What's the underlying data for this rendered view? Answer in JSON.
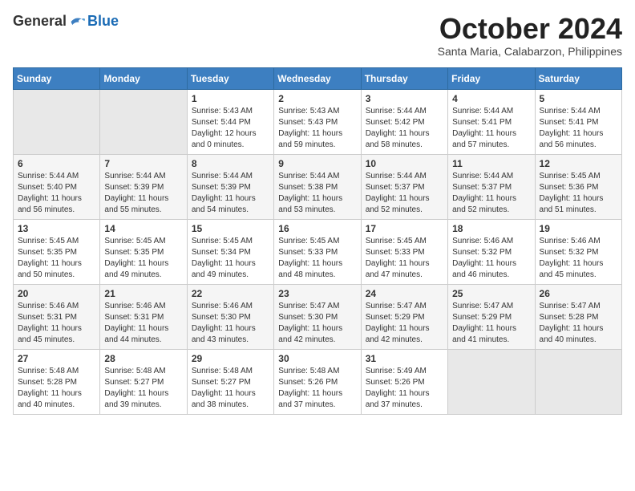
{
  "header": {
    "logo_general": "General",
    "logo_blue": "Blue",
    "month_title": "October 2024",
    "subtitle": "Santa Maria, Calabarzon, Philippines"
  },
  "weekdays": [
    "Sunday",
    "Monday",
    "Tuesday",
    "Wednesday",
    "Thursday",
    "Friday",
    "Saturday"
  ],
  "weeks": [
    [
      {
        "day": "",
        "empty": true
      },
      {
        "day": "",
        "empty": true
      },
      {
        "day": "1",
        "sunrise": "Sunrise: 5:43 AM",
        "sunset": "Sunset: 5:44 PM",
        "daylight": "Daylight: 12 hours and 0 minutes."
      },
      {
        "day": "2",
        "sunrise": "Sunrise: 5:43 AM",
        "sunset": "Sunset: 5:43 PM",
        "daylight": "Daylight: 11 hours and 59 minutes."
      },
      {
        "day": "3",
        "sunrise": "Sunrise: 5:44 AM",
        "sunset": "Sunset: 5:42 PM",
        "daylight": "Daylight: 11 hours and 58 minutes."
      },
      {
        "day": "4",
        "sunrise": "Sunrise: 5:44 AM",
        "sunset": "Sunset: 5:41 PM",
        "daylight": "Daylight: 11 hours and 57 minutes."
      },
      {
        "day": "5",
        "sunrise": "Sunrise: 5:44 AM",
        "sunset": "Sunset: 5:41 PM",
        "daylight": "Daylight: 11 hours and 56 minutes."
      }
    ],
    [
      {
        "day": "6",
        "sunrise": "Sunrise: 5:44 AM",
        "sunset": "Sunset: 5:40 PM",
        "daylight": "Daylight: 11 hours and 56 minutes."
      },
      {
        "day": "7",
        "sunrise": "Sunrise: 5:44 AM",
        "sunset": "Sunset: 5:39 PM",
        "daylight": "Daylight: 11 hours and 55 minutes."
      },
      {
        "day": "8",
        "sunrise": "Sunrise: 5:44 AM",
        "sunset": "Sunset: 5:39 PM",
        "daylight": "Daylight: 11 hours and 54 minutes."
      },
      {
        "day": "9",
        "sunrise": "Sunrise: 5:44 AM",
        "sunset": "Sunset: 5:38 PM",
        "daylight": "Daylight: 11 hours and 53 minutes."
      },
      {
        "day": "10",
        "sunrise": "Sunrise: 5:44 AM",
        "sunset": "Sunset: 5:37 PM",
        "daylight": "Daylight: 11 hours and 52 minutes."
      },
      {
        "day": "11",
        "sunrise": "Sunrise: 5:44 AM",
        "sunset": "Sunset: 5:37 PM",
        "daylight": "Daylight: 11 hours and 52 minutes."
      },
      {
        "day": "12",
        "sunrise": "Sunrise: 5:45 AM",
        "sunset": "Sunset: 5:36 PM",
        "daylight": "Daylight: 11 hours and 51 minutes."
      }
    ],
    [
      {
        "day": "13",
        "sunrise": "Sunrise: 5:45 AM",
        "sunset": "Sunset: 5:35 PM",
        "daylight": "Daylight: 11 hours and 50 minutes."
      },
      {
        "day": "14",
        "sunrise": "Sunrise: 5:45 AM",
        "sunset": "Sunset: 5:35 PM",
        "daylight": "Daylight: 11 hours and 49 minutes."
      },
      {
        "day": "15",
        "sunrise": "Sunrise: 5:45 AM",
        "sunset": "Sunset: 5:34 PM",
        "daylight": "Daylight: 11 hours and 49 minutes."
      },
      {
        "day": "16",
        "sunrise": "Sunrise: 5:45 AM",
        "sunset": "Sunset: 5:33 PM",
        "daylight": "Daylight: 11 hours and 48 minutes."
      },
      {
        "day": "17",
        "sunrise": "Sunrise: 5:45 AM",
        "sunset": "Sunset: 5:33 PM",
        "daylight": "Daylight: 11 hours and 47 minutes."
      },
      {
        "day": "18",
        "sunrise": "Sunrise: 5:46 AM",
        "sunset": "Sunset: 5:32 PM",
        "daylight": "Daylight: 11 hours and 46 minutes."
      },
      {
        "day": "19",
        "sunrise": "Sunrise: 5:46 AM",
        "sunset": "Sunset: 5:32 PM",
        "daylight": "Daylight: 11 hours and 45 minutes."
      }
    ],
    [
      {
        "day": "20",
        "sunrise": "Sunrise: 5:46 AM",
        "sunset": "Sunset: 5:31 PM",
        "daylight": "Daylight: 11 hours and 45 minutes."
      },
      {
        "day": "21",
        "sunrise": "Sunrise: 5:46 AM",
        "sunset": "Sunset: 5:31 PM",
        "daylight": "Daylight: 11 hours and 44 minutes."
      },
      {
        "day": "22",
        "sunrise": "Sunrise: 5:46 AM",
        "sunset": "Sunset: 5:30 PM",
        "daylight": "Daylight: 11 hours and 43 minutes."
      },
      {
        "day": "23",
        "sunrise": "Sunrise: 5:47 AM",
        "sunset": "Sunset: 5:30 PM",
        "daylight": "Daylight: 11 hours and 42 minutes."
      },
      {
        "day": "24",
        "sunrise": "Sunrise: 5:47 AM",
        "sunset": "Sunset: 5:29 PM",
        "daylight": "Daylight: 11 hours and 42 minutes."
      },
      {
        "day": "25",
        "sunrise": "Sunrise: 5:47 AM",
        "sunset": "Sunset: 5:29 PM",
        "daylight": "Daylight: 11 hours and 41 minutes."
      },
      {
        "day": "26",
        "sunrise": "Sunrise: 5:47 AM",
        "sunset": "Sunset: 5:28 PM",
        "daylight": "Daylight: 11 hours and 40 minutes."
      }
    ],
    [
      {
        "day": "27",
        "sunrise": "Sunrise: 5:48 AM",
        "sunset": "Sunset: 5:28 PM",
        "daylight": "Daylight: 11 hours and 40 minutes."
      },
      {
        "day": "28",
        "sunrise": "Sunrise: 5:48 AM",
        "sunset": "Sunset: 5:27 PM",
        "daylight": "Daylight: 11 hours and 39 minutes."
      },
      {
        "day": "29",
        "sunrise": "Sunrise: 5:48 AM",
        "sunset": "Sunset: 5:27 PM",
        "daylight": "Daylight: 11 hours and 38 minutes."
      },
      {
        "day": "30",
        "sunrise": "Sunrise: 5:48 AM",
        "sunset": "Sunset: 5:26 PM",
        "daylight": "Daylight: 11 hours and 37 minutes."
      },
      {
        "day": "31",
        "sunrise": "Sunrise: 5:49 AM",
        "sunset": "Sunset: 5:26 PM",
        "daylight": "Daylight: 11 hours and 37 minutes."
      },
      {
        "day": "",
        "empty": true
      },
      {
        "day": "",
        "empty": true
      }
    ]
  ]
}
